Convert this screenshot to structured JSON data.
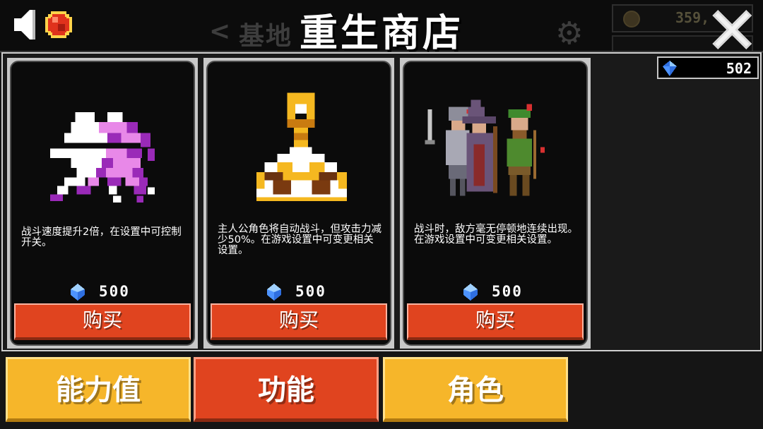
{
  "header": {
    "title": "重生商店",
    "ghost_back": "<",
    "ghost_title": "基地",
    "ghost_coins": "359,"
  },
  "balance": {
    "value": "502",
    "icon": "gem-icon"
  },
  "cards": [
    {
      "art": "purple-white-creature",
      "description": "战斗速度提升2倍，在设置中可控制开关。",
      "price": "500",
      "buy_label": "购买"
    },
    {
      "art": "golden-key-pudding",
      "description": "主人公角色将自动战斗，但攻击力减少50%。在游戏设置中可变更相关设置。",
      "price": "500",
      "buy_label": "购买"
    },
    {
      "art": "three-heroes",
      "description": "战斗时，敌方毫无停顿地连续出现。在游戏设置中可变更相关设置。",
      "price": "500",
      "buy_label": "购买"
    }
  ],
  "tabs": [
    {
      "label": "能力值",
      "state": "normal"
    },
    {
      "label": "功能",
      "state": "selected"
    },
    {
      "label": "角色",
      "state": "normal"
    }
  ],
  "colors": {
    "accent_red": "#e0441f",
    "accent_yellow": "#f6b62a",
    "gem_blue": "#3aa0ff"
  }
}
